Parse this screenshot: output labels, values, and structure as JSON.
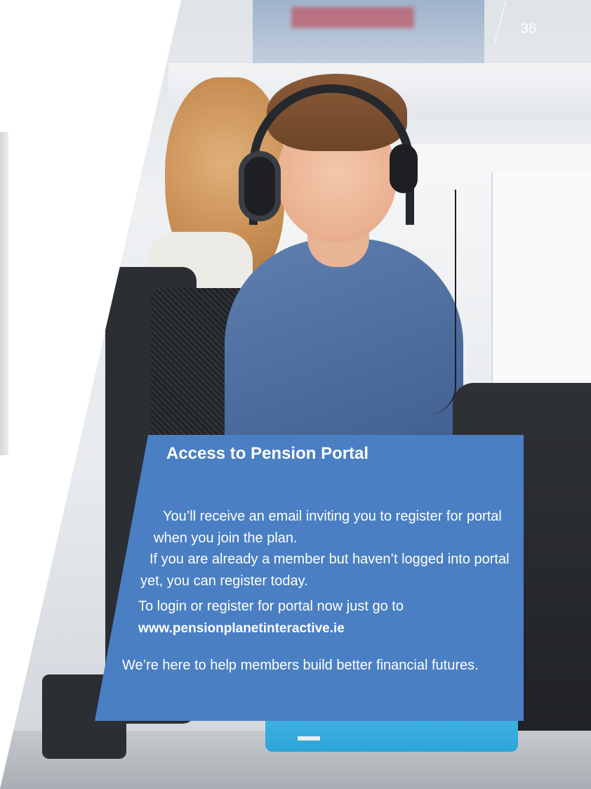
{
  "page": {
    "number": "36"
  },
  "photo": {
    "description_icon": "call-center-agent-photo",
    "colors": {
      "shirt": "#4b6a9c",
      "seat": "#2ea3d6",
      "panel": "#4a7fc3"
    }
  },
  "info_panel": {
    "title": "Access to Pension Portal",
    "paragraph_1": "You’ll receive an email inviting you to register for portal when you join the plan.",
    "paragraph_2": "If you are already a member but haven’t logged into portal yet, you can register today.",
    "paragraph_3": "To login or register for portal now just go to",
    "link": "www.pensionplanetinteractive.ie",
    "paragraph_4": "We’re here to help members build better financial futures."
  }
}
